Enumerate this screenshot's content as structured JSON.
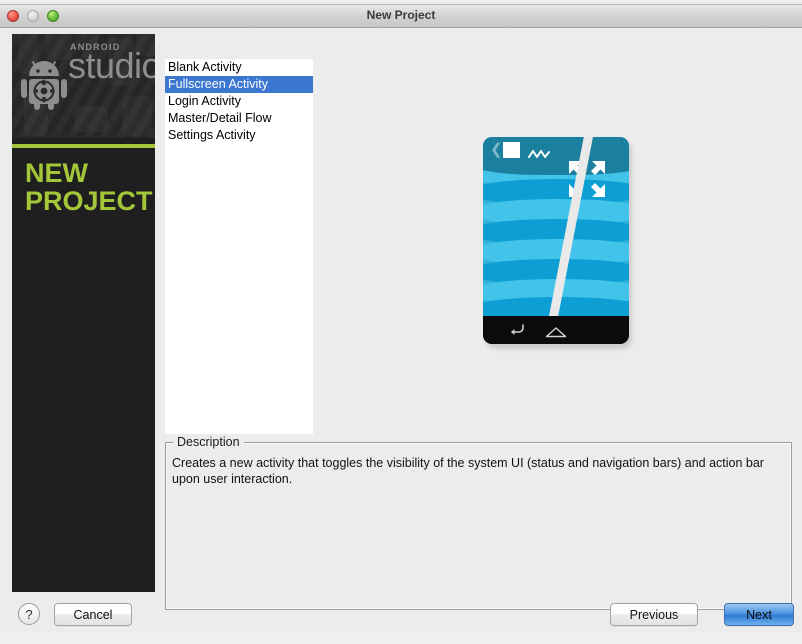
{
  "window": {
    "title": "New Project",
    "traffic_lights": [
      "close-red",
      "minimize-gray",
      "zoom-green"
    ]
  },
  "background_windows": {
    "top_row": "",
    "bottom_row": ""
  },
  "sidebar": {
    "logo": {
      "brand_small": "ANDROID",
      "brand_large": "studio",
      "robot_icon": "android-robot-gear-icon"
    },
    "banner_title": "NEW\nPROJECT",
    "banner_line_1": "NEW",
    "banner_line_2": "PROJECT",
    "accent_color": "#a4c639",
    "background_color": "#1f1f1f"
  },
  "template_list": {
    "selected_index": 1,
    "selection_color": "#3b76d0",
    "items": [
      {
        "label": "Blank Activity"
      },
      {
        "label": "Fullscreen Activity"
      },
      {
        "label": "Login Activity"
      },
      {
        "label": "Master/Detail Flow"
      },
      {
        "label": "Settings Activity"
      }
    ]
  },
  "preview": {
    "name": "fullscreen-activity-preview",
    "action_bar": {
      "back_icon": "chevron-left-icon",
      "menu_square_icon": "square-icon",
      "wave_icon": "zigzag-icon"
    },
    "content_icon": "fullscreen-expand-icon",
    "nav_bar": {
      "back_icon": "nav-back-icon",
      "home_icon": "nav-home-icon"
    },
    "colors": {
      "action_bar": "#1b7f9e",
      "wave_dark": "#0d9fd3",
      "wave_light": "#41c3ea",
      "nav_bar": "#0b0b0b",
      "divider": "#e9e9e9"
    }
  },
  "description": {
    "label": "Description",
    "text": "Creates a new activity that toggles the visibility of the system UI (status and navigation bars) and action bar upon user interaction."
  },
  "footer": {
    "help_label": "?",
    "cancel_label": "Cancel",
    "previous_label": "Previous",
    "next_label": "Next",
    "next_accent": "#2f7ad4"
  }
}
